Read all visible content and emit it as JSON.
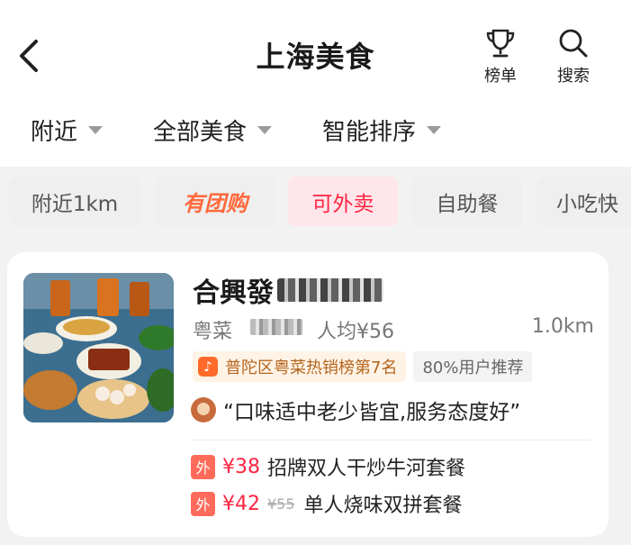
{
  "header": {
    "title": "上海美食",
    "rank_label": "榜单",
    "search_label": "搜索"
  },
  "filters": [
    {
      "label": "附近"
    },
    {
      "label": "全部美食"
    },
    {
      "label": "智能排序"
    }
  ],
  "chips": [
    {
      "label": "附近1km"
    },
    {
      "label": "有团购"
    },
    {
      "label": "可外卖"
    },
    {
      "label": "自助餐"
    },
    {
      "label": "小吃快"
    }
  ],
  "restaurant": {
    "name": "合興發",
    "cuisine": "粤菜",
    "price": "人均¥56",
    "distance": "1.0km",
    "rank_tag": "普陀区粤菜热销榜第7名",
    "recommend_tag": "80%用户推荐",
    "review": "“口味适中老少皆宜,服务态度好”",
    "deals": [
      {
        "badge": "外",
        "price": "¥38",
        "old_price": "",
        "name": "招牌双人干炒牛河套餐"
      },
      {
        "badge": "外",
        "price": "¥42",
        "old_price": "¥55",
        "name": "单人烧味双拼套餐"
      }
    ]
  },
  "colors": {
    "accent": "#ff2442",
    "groupbuy": "#ff6a3d",
    "rank_tag_bg": "#fff3e6"
  }
}
